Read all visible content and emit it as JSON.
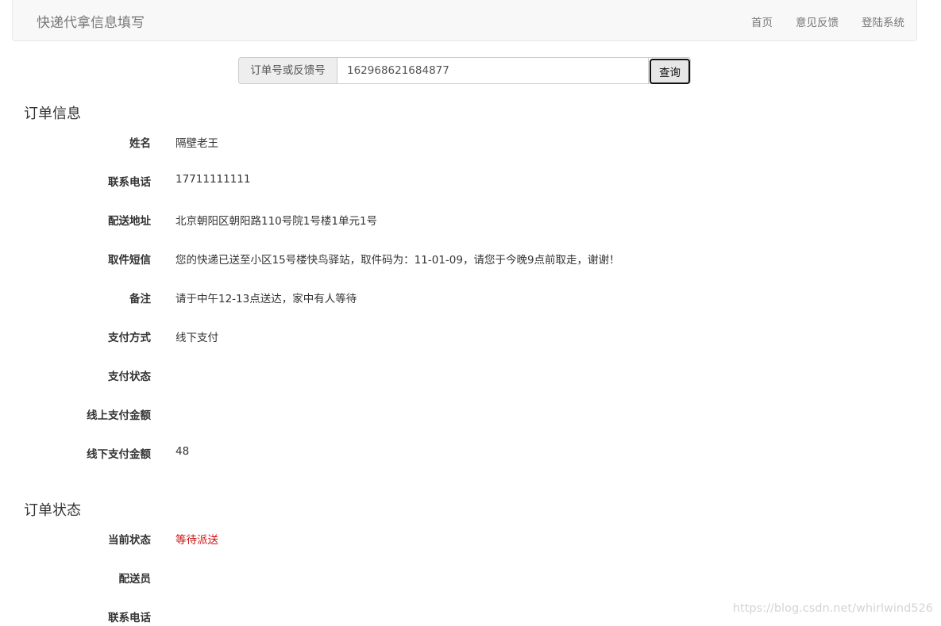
{
  "navbar": {
    "brand": "快递代拿信息填写",
    "links": [
      "首页",
      "意见反馈",
      "登陆系统"
    ]
  },
  "search": {
    "addon_label": "订单号或反馈号",
    "value": "162968621684877",
    "button_label": "查询"
  },
  "order_info": {
    "title": "订单信息",
    "fields": [
      {
        "label": "姓名",
        "value": "隔壁老王"
      },
      {
        "label": "联系电话",
        "value": "17711111111"
      },
      {
        "label": "配送地址",
        "value": "北京朝阳区朝阳路110号院1号楼1单元1号"
      },
      {
        "label": "取件短信",
        "value": "您的快递已送至小区15号楼快鸟驿站，取件码为：11-01-09，请您于今晚9点前取走，谢谢！"
      },
      {
        "label": "备注",
        "value": "请于中午12-13点送达，家中有人等待"
      },
      {
        "label": "支付方式",
        "value": "线下支付"
      },
      {
        "label": "支付状态",
        "value": ""
      },
      {
        "label": "线上支付金额",
        "value": ""
      },
      {
        "label": "线下支付金额",
        "value": "48"
      }
    ]
  },
  "order_status": {
    "title": "订单状态",
    "fields": [
      {
        "label": "当前状态",
        "value": "等待派送",
        "color": "#cc1111"
      },
      {
        "label": "配送员",
        "value": ""
      },
      {
        "label": "联系电话",
        "value": ""
      }
    ]
  },
  "watermark": "https://blog.csdn.net/whirlwind526"
}
